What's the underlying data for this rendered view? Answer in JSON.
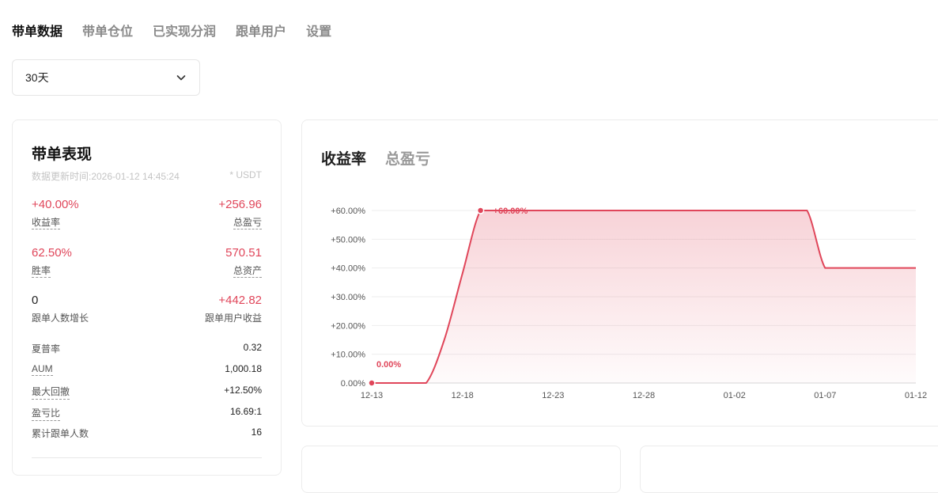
{
  "tabs": [
    "带单数据",
    "带单仓位",
    "已实现分润",
    "跟单用户",
    "设置"
  ],
  "active_tab": 0,
  "period_select": {
    "value": "30天",
    "icon": "chevron-down-icon"
  },
  "performance": {
    "title": "带单表现",
    "update_time": "数据更新时间:2026-01-12 14:45:24",
    "unit_note": "* USDT",
    "stats": [
      {
        "value": "+40.00%",
        "label": "收益率",
        "color": "#e0465a"
      },
      {
        "value": "+256.96",
        "label": "总盈亏",
        "color": "#e0465a"
      },
      {
        "value": "62.50%",
        "label": "胜率",
        "color": "#e0465a"
      },
      {
        "value": "570.51",
        "label": "总资产",
        "color": "#e0465a"
      },
      {
        "value": "0",
        "label": "跟单人数增长",
        "color": "#1f1f1f"
      },
      {
        "value": "+442.82",
        "label": "跟单用户收益",
        "color": "#e0465a"
      }
    ],
    "details": [
      {
        "label": "夏普率",
        "value": "0.32"
      },
      {
        "label": "AUM",
        "value": "1,000.18"
      },
      {
        "label": "最大回撤",
        "value": "+12.50%"
      },
      {
        "label": "盈亏比",
        "value": "16.69:1"
      },
      {
        "label": "累计跟单人数",
        "value": "16"
      }
    ]
  },
  "chart_tabs": [
    "收益率",
    "总盈亏"
  ],
  "active_chart_tab": 0,
  "colors": {
    "accent": "#e0465a"
  },
  "chart_data": {
    "type": "area",
    "x": [
      "12-13",
      "12-14",
      "12-15",
      "12-16",
      "12-17",
      "12-18",
      "12-19",
      "12-20",
      "12-21",
      "12-22",
      "12-23",
      "12-24",
      "12-25",
      "12-26",
      "12-27",
      "12-28",
      "12-29",
      "12-30",
      "12-31",
      "01-01",
      "01-02",
      "01-03",
      "01-04",
      "01-05",
      "01-06",
      "01-07",
      "01-08",
      "01-09",
      "01-10",
      "01-11",
      "01-12"
    ],
    "values": [
      0,
      0,
      0,
      0,
      15,
      38,
      60,
      60,
      60,
      60,
      60,
      60,
      60,
      60,
      60,
      60,
      60,
      60,
      60,
      60,
      60,
      60,
      60,
      60,
      60,
      40,
      40,
      40,
      40,
      40,
      40
    ],
    "xticks": [
      "12-13",
      "12-18",
      "12-23",
      "12-28",
      "01-02",
      "01-07",
      "01-12"
    ],
    "yticks": [
      "0.00%",
      "+10.00%",
      "+20.00%",
      "+30.00%",
      "+40.00%",
      "+50.00%",
      "+60.00%"
    ],
    "ylim": [
      0,
      60
    ],
    "annotations": [
      {
        "x": "12-13",
        "label": "0.00%"
      },
      {
        "x": "12-19",
        "label": "+60.00%"
      }
    ],
    "grid": true
  }
}
